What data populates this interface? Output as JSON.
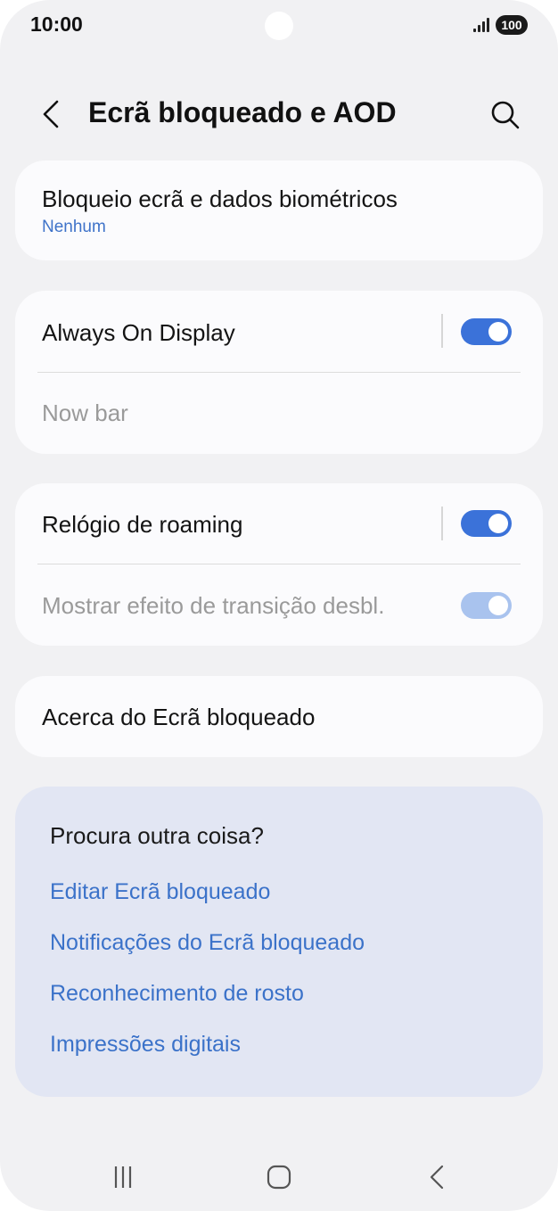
{
  "status_bar": {
    "time": "10:00",
    "battery": "100",
    "icons": [
      "signal-icon",
      "battery-icon"
    ]
  },
  "header": {
    "title": "Ecrã bloqueado e AOD",
    "back_icon": "chevron-left-icon",
    "search_icon": "search-icon"
  },
  "lock_screen_card": {
    "title": "Bloqueio ecrã e dados biométricos",
    "subtitle": "Nenhum"
  },
  "aod_card": {
    "always_on_display": {
      "label": "Always On Display",
      "enabled": true
    },
    "now_bar": {
      "label": "Now bar",
      "dimmed": true
    }
  },
  "roaming_card": {
    "roaming_clock": {
      "label": "Relógio de roaming",
      "enabled": true
    },
    "unlock_transition": {
      "label": "Mostrar efeito de transição desbl.",
      "enabled": true,
      "dimmed": true
    }
  },
  "about_card": {
    "label": "Acerca do Ecrã bloqueado"
  },
  "suggestions": {
    "title": "Procura outra coisa?",
    "links": [
      "Editar Ecrã bloqueado",
      "Notificações do Ecrã bloqueado",
      "Reconhecimento de rosto",
      "Impressões digitais"
    ]
  },
  "nav_bar": {
    "icons": [
      "recent-apps-icon",
      "home-icon",
      "back-icon"
    ]
  },
  "colors": {
    "accent": "#3b72d9",
    "link": "#3b72c9",
    "background": "#f1f1f3",
    "card": "#fbfbfd",
    "suggestion_background": "#e2e6f3"
  }
}
